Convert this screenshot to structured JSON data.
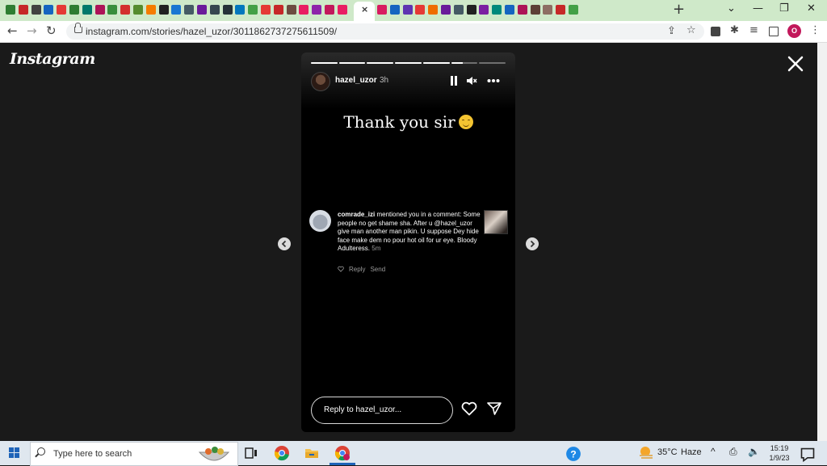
{
  "browser": {
    "url": "instagram.com/stories/hazel_uzor/3011862737275611509/",
    "new_tab_label": "+",
    "tab_close_label": "×",
    "window_controls": [
      "⌄",
      "—",
      "❐",
      "✕"
    ]
  },
  "page": {
    "logo_text": "Instagram",
    "story": {
      "username": "hazel_uzor",
      "time_ago": "3h",
      "progress_segments": 7,
      "active_segment": 6,
      "active_segment_fill": 0.45,
      "headline": "Thank you sir",
      "comment": {
        "author": "comrade_izi",
        "text": " mentioned you in a comment: Some people no get shame sha. After u @hazel_uzor give man another man pikin. U suppose Dey hide face make dem no pour hot oil for ur eye. Bloody Adulteress.",
        "time": "5m",
        "reply_label": "Reply",
        "send_label": "Send"
      },
      "reply_placeholder": "Reply to hazel_uzor..."
    }
  },
  "taskbar": {
    "search_placeholder": "Type here to search",
    "temperature": "35°C",
    "weather": "Haze",
    "time": "15:19",
    "date": "1/9/23"
  },
  "colors": {
    "tabstrip": "#cfe9c9",
    "page_bg": "#1a1a1a",
    "story_bg": "#000000",
    "profile": "#c2185b"
  }
}
